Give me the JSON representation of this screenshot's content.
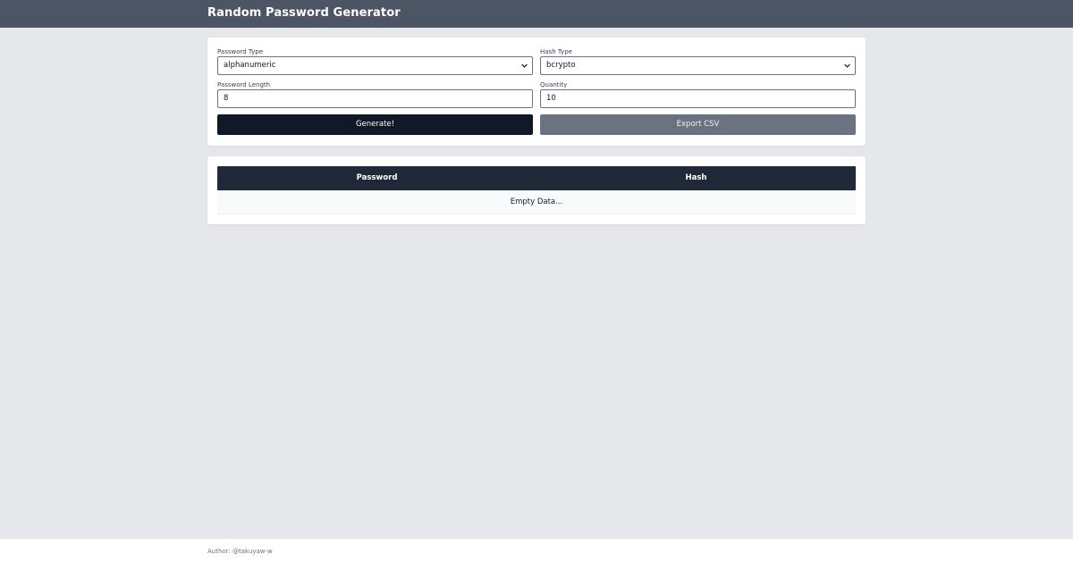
{
  "app": {
    "title": "Random Password Generator"
  },
  "form": {
    "password_type": {
      "label": "Password Type",
      "value": "alphanumeric"
    },
    "hash_type": {
      "label": "Hash Type",
      "value": "bcrypto"
    },
    "password_length": {
      "label": "Password Length",
      "value": "8"
    },
    "quantity": {
      "label": "Quantity",
      "value": "10"
    },
    "generate_label": "Generate!",
    "export_label": "Export CSV"
  },
  "table": {
    "columns": [
      "Password",
      "Hash"
    ],
    "empty_text": "Empty Data..."
  },
  "footer": {
    "author": "Author: @takuyaw-w"
  },
  "colors": {
    "header_bg": "#4b5563",
    "page_bg": "#e5e7eb",
    "primary_button": "#111827",
    "disabled_button": "#6b7280",
    "table_header": "#1f2937"
  }
}
